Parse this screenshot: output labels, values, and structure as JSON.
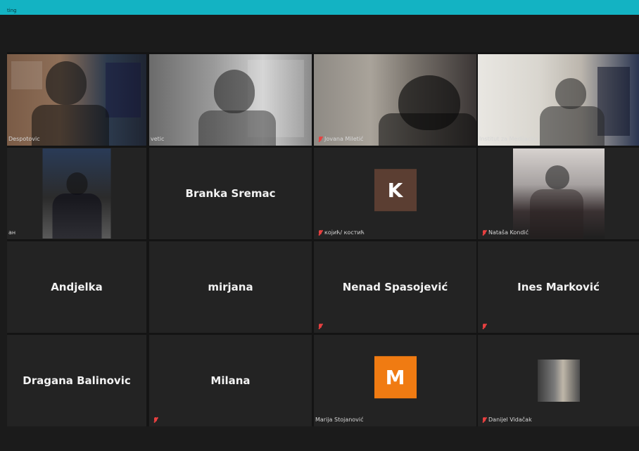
{
  "window": {
    "title_fragment": "ting"
  },
  "gallery": {
    "tiles": [
      {
        "id": "r1c1",
        "type": "video",
        "label": "Despotovic",
        "muted": false,
        "speaking": false
      },
      {
        "id": "r1c2",
        "type": "video",
        "label": "vetic",
        "muted": false,
        "speaking": false
      },
      {
        "id": "r1c3",
        "type": "video",
        "label": "Jovana Miletić",
        "muted": true,
        "speaking": false
      },
      {
        "id": "r1c4",
        "type": "video",
        "label": "Institut za Medijaciju",
        "muted": false,
        "speaking": true
      },
      {
        "id": "r2c1",
        "type": "video",
        "label": "ан",
        "muted": false,
        "speaking": false
      },
      {
        "id": "r2c2",
        "type": "name",
        "center_name": "Branka Sremac",
        "label": "",
        "muted": false,
        "speaking": false
      },
      {
        "id": "r2c3",
        "type": "avatar",
        "avatar_letter": "K",
        "avatar_color": "#5b3e32",
        "label": "којић/ костић",
        "muted": true,
        "speaking": false
      },
      {
        "id": "r2c4",
        "type": "video",
        "label": "Nataša Kondić",
        "muted": true,
        "speaking": false
      },
      {
        "id": "r3c1",
        "type": "name",
        "center_name": "Andjelka",
        "label": "",
        "muted": false,
        "speaking": false
      },
      {
        "id": "r3c2",
        "type": "name",
        "center_name": "mirjana",
        "label": "",
        "muted": false,
        "speaking": false
      },
      {
        "id": "r3c3",
        "type": "name",
        "center_name": "Nenad Spasojević",
        "label": "",
        "muted": true,
        "speaking": false
      },
      {
        "id": "r3c4",
        "type": "name",
        "center_name": "Ines Marković",
        "label": "",
        "muted": true,
        "speaking": false
      },
      {
        "id": "r4c1",
        "type": "name",
        "center_name": "Dragana Balinovic",
        "label": "",
        "muted": false,
        "speaking": false
      },
      {
        "id": "r4c2",
        "type": "name",
        "center_name": "Milana",
        "label": "",
        "muted": true,
        "speaking": false
      },
      {
        "id": "r4c3",
        "type": "avatar",
        "avatar_letter": "M",
        "avatar_color": "#f07b12",
        "label": "Marija Stojanović",
        "muted": false,
        "speaking": false
      },
      {
        "id": "r4c4",
        "type": "video",
        "label": "Danijel Vidačak",
        "muted": true,
        "speaking": false
      }
    ]
  },
  "colors": {
    "titlebar": "#13b3c3",
    "speaker_outline": "#f7f03d",
    "muted_mic": "#e84040"
  }
}
